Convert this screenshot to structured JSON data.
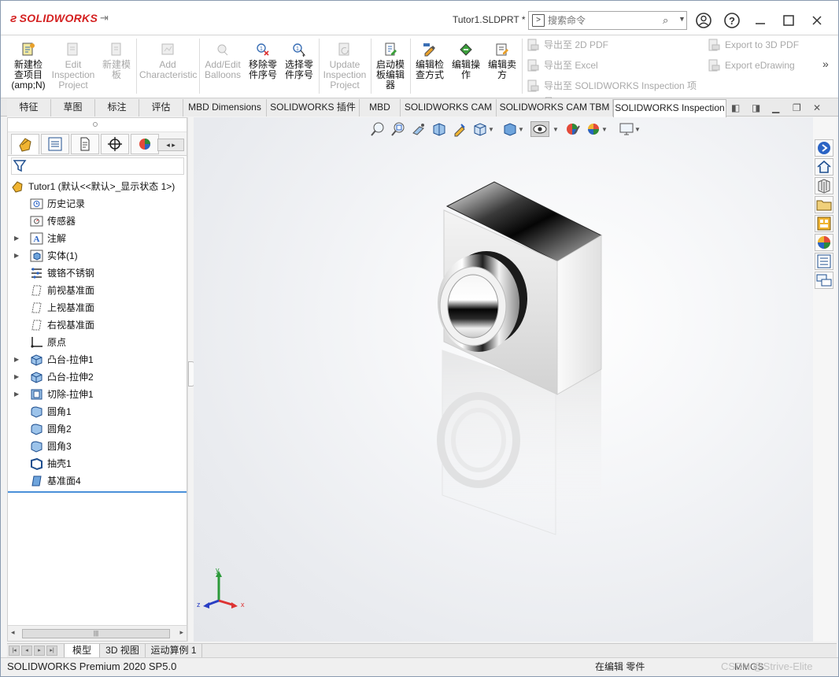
{
  "app": {
    "logo": "SOLIDWORKS",
    "doc_title": "Tutor1.SLDPRT *",
    "search_placeholder": "搜索命令"
  },
  "commands": {
    "new_project": "新建检查项目(amp;N)",
    "edit_project": "Edit Inspection Project",
    "new_template": "新建模板",
    "add_characteristic": "Add Characteristic",
    "add_edit_balloons": "Add/Edit Balloons",
    "remove_seq": "移除零件序号",
    "select_seq": "选择零件序号",
    "update_project": "Update Inspection Project",
    "launch_template_editor": "启动模板编辑器",
    "edit_inspection_method": "编辑检查方式",
    "edit_operation": "编辑操作",
    "edit_vendor": "编辑卖方",
    "export_2d_pdf": "导出至 2D PDF",
    "export_excel": "导出至 Excel",
    "export_inspection_project": "导出至 SOLIDWORKS Inspection 项目",
    "export_3d_pdf": "Export to 3D PDF",
    "export_edrawing": "Export eDrawing"
  },
  "tabs": [
    "特征",
    "草图",
    "标注",
    "评估",
    "MBD Dimensions",
    "SOLIDWORKS 插件",
    "MBD",
    "SOLIDWORKS CAM",
    "SOLIDWORKS CAM TBM",
    "SOLIDWORKS Inspection"
  ],
  "active_tab": "SOLIDWORKS Inspection",
  "tree": {
    "root": "Tutor1 (默认<<默认>_显示状态 1>)",
    "items": [
      "历史记录",
      "传感器",
      "注解",
      "实体(1)",
      "镀铬不锈钢",
      "前视基准面",
      "上视基准面",
      "右视基准面",
      "原点",
      "凸台-拉伸1",
      "凸台-拉伸2",
      "切除-拉伸1",
      "圆角1",
      "圆角2",
      "圆角3",
      "抽壳1",
      "基准面4"
    ]
  },
  "triad": {
    "x": "x",
    "y": "y",
    "z": "z"
  },
  "model_tabs": [
    "模型",
    "3D 视图",
    "运动算例 1"
  ],
  "status": {
    "left": "SOLIDWORKS Premium 2020 SP5.0",
    "middle": "在编辑 零件",
    "right": "MMGS",
    "watermark": "CSDN @Strive-Elite"
  },
  "colors": {
    "brand": "#d42020",
    "accent": "#4a90d9"
  }
}
